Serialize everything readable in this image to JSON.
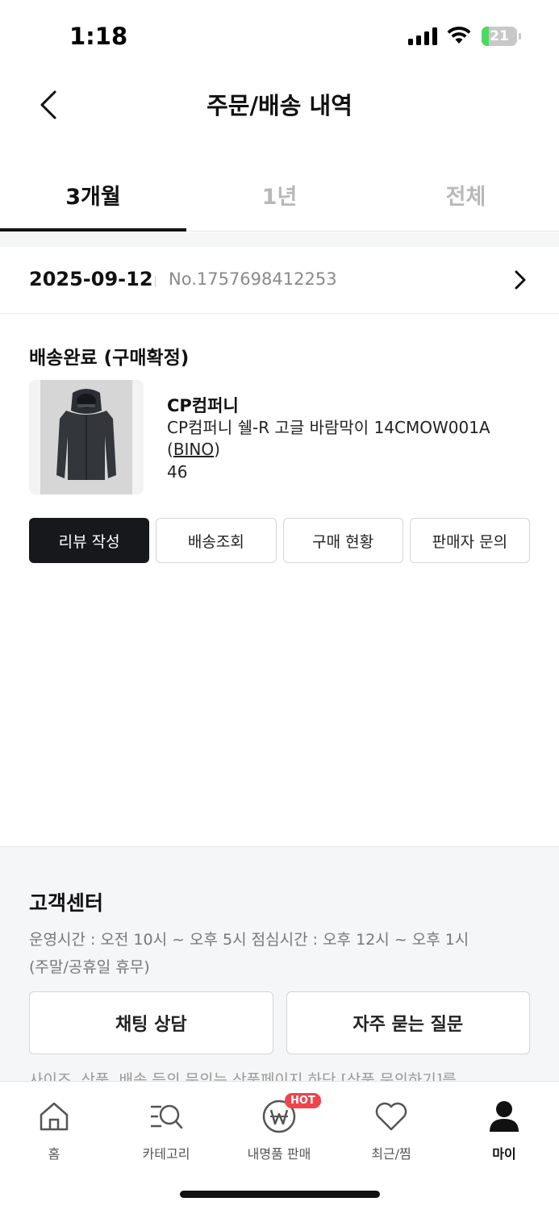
{
  "status_bar": {
    "time": "1:18",
    "battery": "21",
    "battery_level": 0.21
  },
  "header": {
    "title": "주문/배송 내역"
  },
  "tabs": [
    {
      "label": "3개월",
      "active": true
    },
    {
      "label": "1년",
      "active": false
    },
    {
      "label": "전체",
      "active": false
    }
  ],
  "order": {
    "date": "2025-09-12",
    "number": "No.1757698412253",
    "status": "배송완료 (구매확정)",
    "brand": "CP컴퍼니",
    "product_name": "CP컴퍼니 쉘-R 고글 바람막이 14CMOW001A",
    "seller_open": "(",
    "seller": "BINO",
    "seller_close": ")",
    "size": "46",
    "actions": [
      {
        "label": "리뷰 작성"
      },
      {
        "label": "배송조회"
      },
      {
        "label": "구매 현황"
      },
      {
        "label": "판매자 문의"
      }
    ]
  },
  "customer_center": {
    "title": "고객센터",
    "hours": "운영시간 : 오전 10시 ~ 오후 5시 점심시간 : 오후 12시 ~ 오후 1시",
    "holiday": "(주말/공휴일 휴무)",
    "chat_button": "채팅 상담",
    "faq_button": "자주 묻는 질문",
    "notice": "사이즈, 상품, 배송 등의 문의는 상품페이지 하단 [상품 문의하기]를"
  },
  "bottom_nav": [
    {
      "label": "홈",
      "icon": "home-icon"
    },
    {
      "label": "카테고리",
      "icon": "category-search-icon"
    },
    {
      "label": "내명품 판매",
      "icon": "won-coin-icon",
      "badge": "HOT"
    },
    {
      "label": "최근/찜",
      "icon": "heart-icon"
    },
    {
      "label": "마이",
      "icon": "person-icon",
      "active": true
    }
  ],
  "colors": {
    "accent": "#16181b",
    "hot_badge": "#f0434a",
    "battery": "#4cd964"
  }
}
